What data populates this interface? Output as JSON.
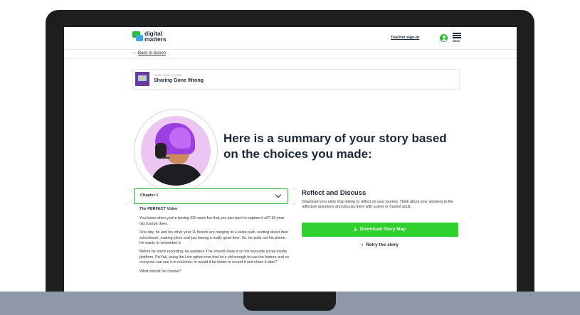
{
  "header": {
    "logo_line1": "digital",
    "logo_line2": "matters",
    "teacher_link": "Teacher sign-in",
    "menu_label": "MENU"
  },
  "nav": {
    "back_arrow": "‹",
    "back_label": "Back to lesson"
  },
  "story": {
    "kicker": "ONCE UPON ONLINE",
    "title": "Sharing Gone Wrong"
  },
  "summary": {
    "headline": "Here is a summary of your story based on the choices you made:"
  },
  "chapter": {
    "label": "Chapter 1",
    "heading": "The PERFECT Video",
    "paragraphs": [
      "You know when you're having SO much fun that you just want to capture it all? 16-year-old Joseph does.",
      "One day, he and his other year 11 friends are hanging at a skate park, venting about their schoolwork, making jokes and just having a really good time. So, he pulls out his phone. He wants to remember it.",
      "Before he starts recording, he wonders if he should share it on his favourite social media platform, PicYak, using the Live option now that he's old enough to use the feature and so everyone can see it in real time; or would it be better to record it and share it later?",
      "What should he choose?"
    ]
  },
  "reflect": {
    "title": "Reflect and Discuss",
    "body": "Download your story map below to reflect on your journey. Think about your answers to the reflection questions and discuss them with a peer or trusted adult.",
    "download_label": "Download Story Map",
    "download_icon": "⤓",
    "retry_label": "Retry the story",
    "retry_icon": "‹"
  },
  "colors": {
    "accent_green": "#2ed12d",
    "brand_green": "#2dbb3b",
    "brand_blue": "#39a9e0",
    "text_dark": "#1a2a3a",
    "laptop_bezel": "#1e1e1e",
    "laptop_base": "#8e98a6"
  }
}
